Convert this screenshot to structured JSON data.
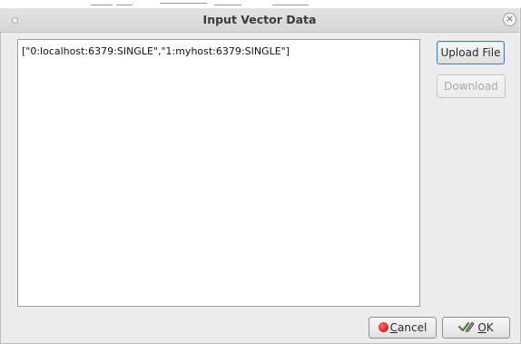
{
  "dialog": {
    "title": "Input Vector Data",
    "close_symbol": "×",
    "text_value": "[\"0:localhost:6379:SINGLE\",\"1:myhost:6379:SINGLE\"]",
    "buttons": {
      "upload_label": "Upload File",
      "download_label": "Download",
      "cancel_mnemonic": "C",
      "cancel_rest": "ancel",
      "ok_mnemonic": "O",
      "ok_rest": "K"
    }
  },
  "icons": {
    "cancel": "red-circle-icon",
    "ok": "checkmark-pen-icon",
    "close": "close-icon",
    "window_menu": "window-menu-dot-icon"
  },
  "colors": {
    "dialog_bg": "#ececec",
    "title_text": "#3a3a3a",
    "focus_border": "#4a7fbf",
    "cancel_icon": "#d40000"
  }
}
